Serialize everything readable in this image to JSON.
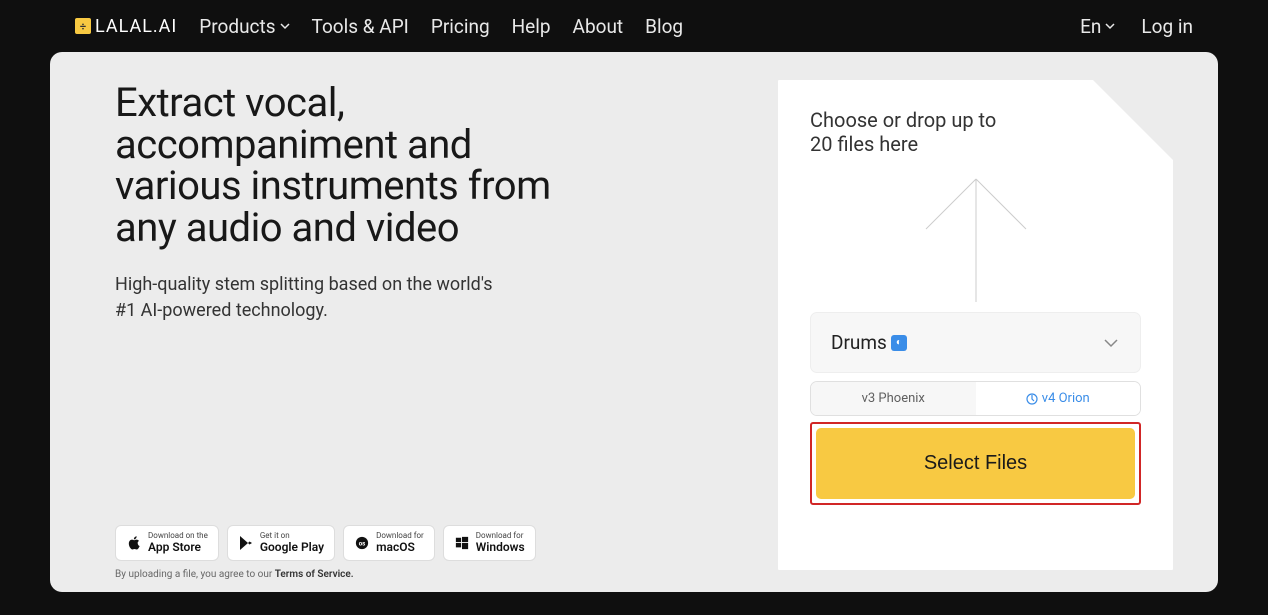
{
  "nav": {
    "logo_text": "LALAL.AI",
    "items": [
      "Products",
      "Tools & API",
      "Pricing",
      "Help",
      "About",
      "Blog"
    ],
    "lang": "En",
    "login": "Log in"
  },
  "hero": {
    "headline": "Extract vocal, accompaniment and various instruments from any audio and video",
    "subhead": "High-quality stem splitting based on the world's #1 AI-powered technology."
  },
  "downloads": {
    "appstore_small": "Download on the",
    "appstore_big": "App Store",
    "gplay_small": "Get it on",
    "gplay_big": "Google Play",
    "macos_small": "Download for",
    "macos_big": "macOS",
    "windows_small": "Download for",
    "windows_big": "Windows"
  },
  "tos": {
    "prefix": "By uploading a file, you agree to our ",
    "link": "Terms of Service."
  },
  "upload": {
    "drop_text": "Choose or drop up to 20 files here",
    "dropdown_value": "Drums",
    "version_a": "v3 Phoenix",
    "version_b": "v4 Orion",
    "select_button": "Select Files"
  }
}
